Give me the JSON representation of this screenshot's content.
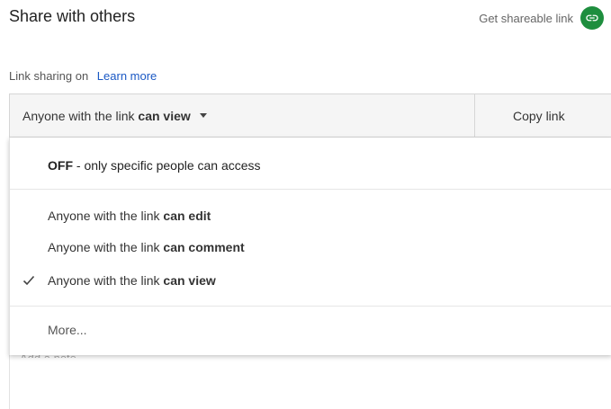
{
  "header": {
    "title": "Share with others",
    "get_link_label": "Get shareable link",
    "link_icon": "link-icon",
    "accent": "#1e8e3e"
  },
  "sharing": {
    "status": "Link sharing on",
    "learn_more": "Learn more"
  },
  "share_bar": {
    "selected_prefix": "Anyone with the link ",
    "selected_bold": "can view",
    "copy_label": "Copy link"
  },
  "menu": {
    "off": {
      "strong": "OFF",
      "rest": " - only specific people can access"
    },
    "options": [
      {
        "prefix": "Anyone with the link ",
        "bold": "can edit",
        "checked": false
      },
      {
        "prefix": "Anyone with the link ",
        "bold": "can comment",
        "checked": false
      },
      {
        "prefix": "Anyone with the link ",
        "bold": "can view",
        "checked": true
      }
    ],
    "more": "More..."
  },
  "note": {
    "placeholder": "Add a note..."
  }
}
